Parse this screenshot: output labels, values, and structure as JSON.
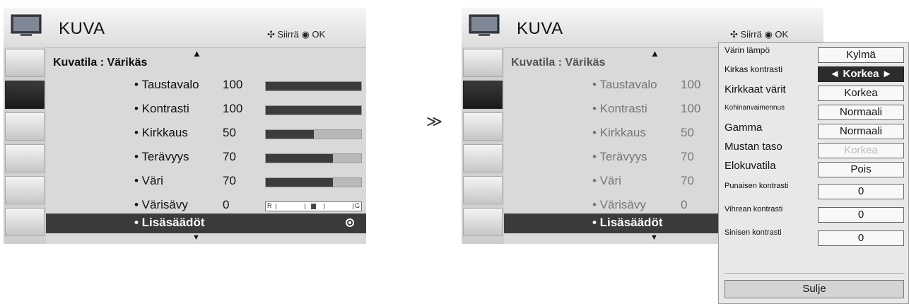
{
  "left_menu": {
    "title": "KUVA",
    "nav_hint": "✣ Siirrä  ◉ OK",
    "mode": "Kuvatila : Värikäs",
    "items": [
      {
        "label": "• Taustavalo",
        "value": "100",
        "level": 1.0
      },
      {
        "label": "• Kontrasti",
        "value": "100",
        "level": 1.0
      },
      {
        "label": "• Kirkkaus",
        "value": "50",
        "level": 0.5
      },
      {
        "label": "• Terävyys",
        "value": "70",
        "level": 0.7
      },
      {
        "label": "• Väri",
        "value": "70",
        "level": 0.7
      },
      {
        "label": "• Värisävy",
        "value": "0",
        "tint_left": "R",
        "tint_right": "G"
      }
    ],
    "selected": "• Lisäsäädöt"
  },
  "separator": "≫",
  "right_menu": {
    "title": "KUVA",
    "nav_hint": "✣ Siirrä  ◉ OK",
    "mode": "Kuvatila : Värikäs",
    "items": [
      {
        "label": "• Taustavalo",
        "value": "100"
      },
      {
        "label": "• Kontrasti",
        "value": "100"
      },
      {
        "label": "• Kirkkaus",
        "value": "50"
      },
      {
        "label": "• Terävyys",
        "value": "70"
      },
      {
        "label": "• Väri",
        "value": "70"
      },
      {
        "label": "• Värisävy",
        "value": "0"
      }
    ],
    "selected": "• Lisäsäädöt"
  },
  "popup": {
    "rows": [
      {
        "label": "Värin lämpö",
        "value": "Kylmä"
      },
      {
        "label": "Kirkas kontrasti",
        "value": "◄  Korkea  ►"
      },
      {
        "label": "Kirkkaat värit",
        "value": "Korkea"
      },
      {
        "label": "Kohinanvaimennus",
        "value": "Normaali"
      },
      {
        "label": "Gamma",
        "value": "Normaali"
      },
      {
        "label": "Mustan taso",
        "value": "Korkea"
      },
      {
        "label": "Elokuvatila",
        "value": "Pois"
      },
      {
        "label": "Punaisen kontrasti",
        "value": "0"
      },
      {
        "label": "Vihrean kontrasti",
        "value": "0"
      },
      {
        "label": "Sinisen kontrasti",
        "value": "0"
      }
    ],
    "close_label": "Sulje"
  },
  "colors": {
    "selected_bg": "#3b3b3b",
    "bar_fill": "#3c3c3c",
    "panel_bg": "#d9d9d9"
  }
}
